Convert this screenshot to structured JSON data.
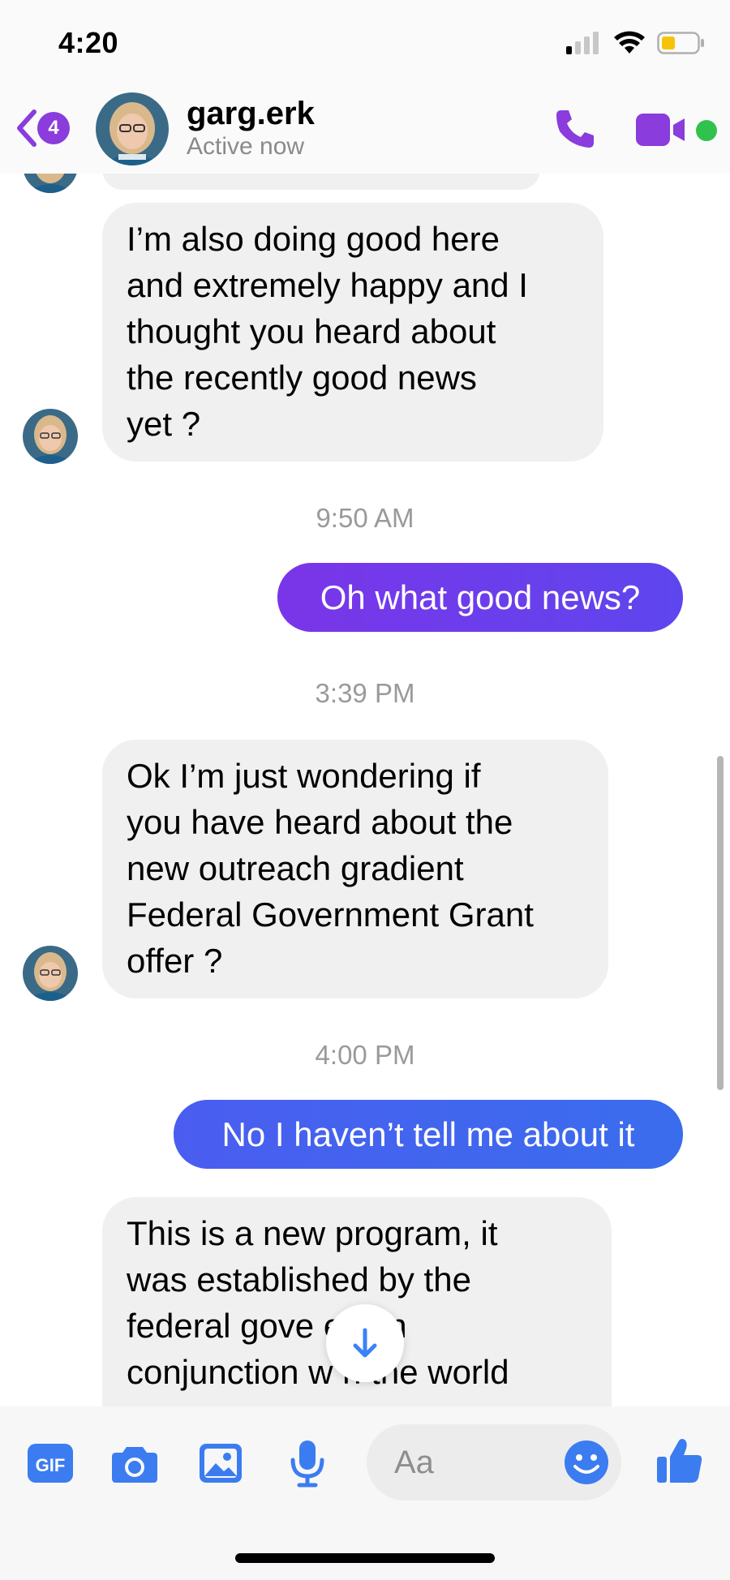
{
  "status_bar": {
    "time": "4:20"
  },
  "header": {
    "back_count": "4",
    "contact_name": "garg.erk",
    "status": "Active now"
  },
  "colors": {
    "accent": "#8a3cdc",
    "outgoing_1": "#6d3cf0",
    "outgoing_2": "#3f66ec",
    "online": "#31c24d"
  },
  "messages": [
    {
      "type": "incoming",
      "text": "I’m also doing good here\nand extremely happy and I\nthought you heard about\nthe recently good news\nyet ?"
    },
    {
      "type": "time",
      "text": "9:50 AM"
    },
    {
      "type": "outgoing",
      "text": "Oh what good news?"
    },
    {
      "type": "time",
      "text": "3:39 PM"
    },
    {
      "type": "incoming",
      "text": "Ok I’m just wondering if\nyou have heard about the\nnew outreach gradient\nFederal Government Grant\noffer ?"
    },
    {
      "type": "time",
      "text": "4:00 PM"
    },
    {
      "type": "outgoing",
      "text": "No I haven’t tell me about it"
    },
    {
      "type": "incoming",
      "text": "This is a new program, it\nwas established by the\nfederal gove    ent in\nconjunction w  h the world"
    }
  ],
  "composer": {
    "placeholder": "Aa",
    "icons": [
      "gif-icon",
      "camera-icon",
      "image-icon",
      "microphone-icon",
      "emoji-icon",
      "thumbs-up-icon"
    ]
  }
}
